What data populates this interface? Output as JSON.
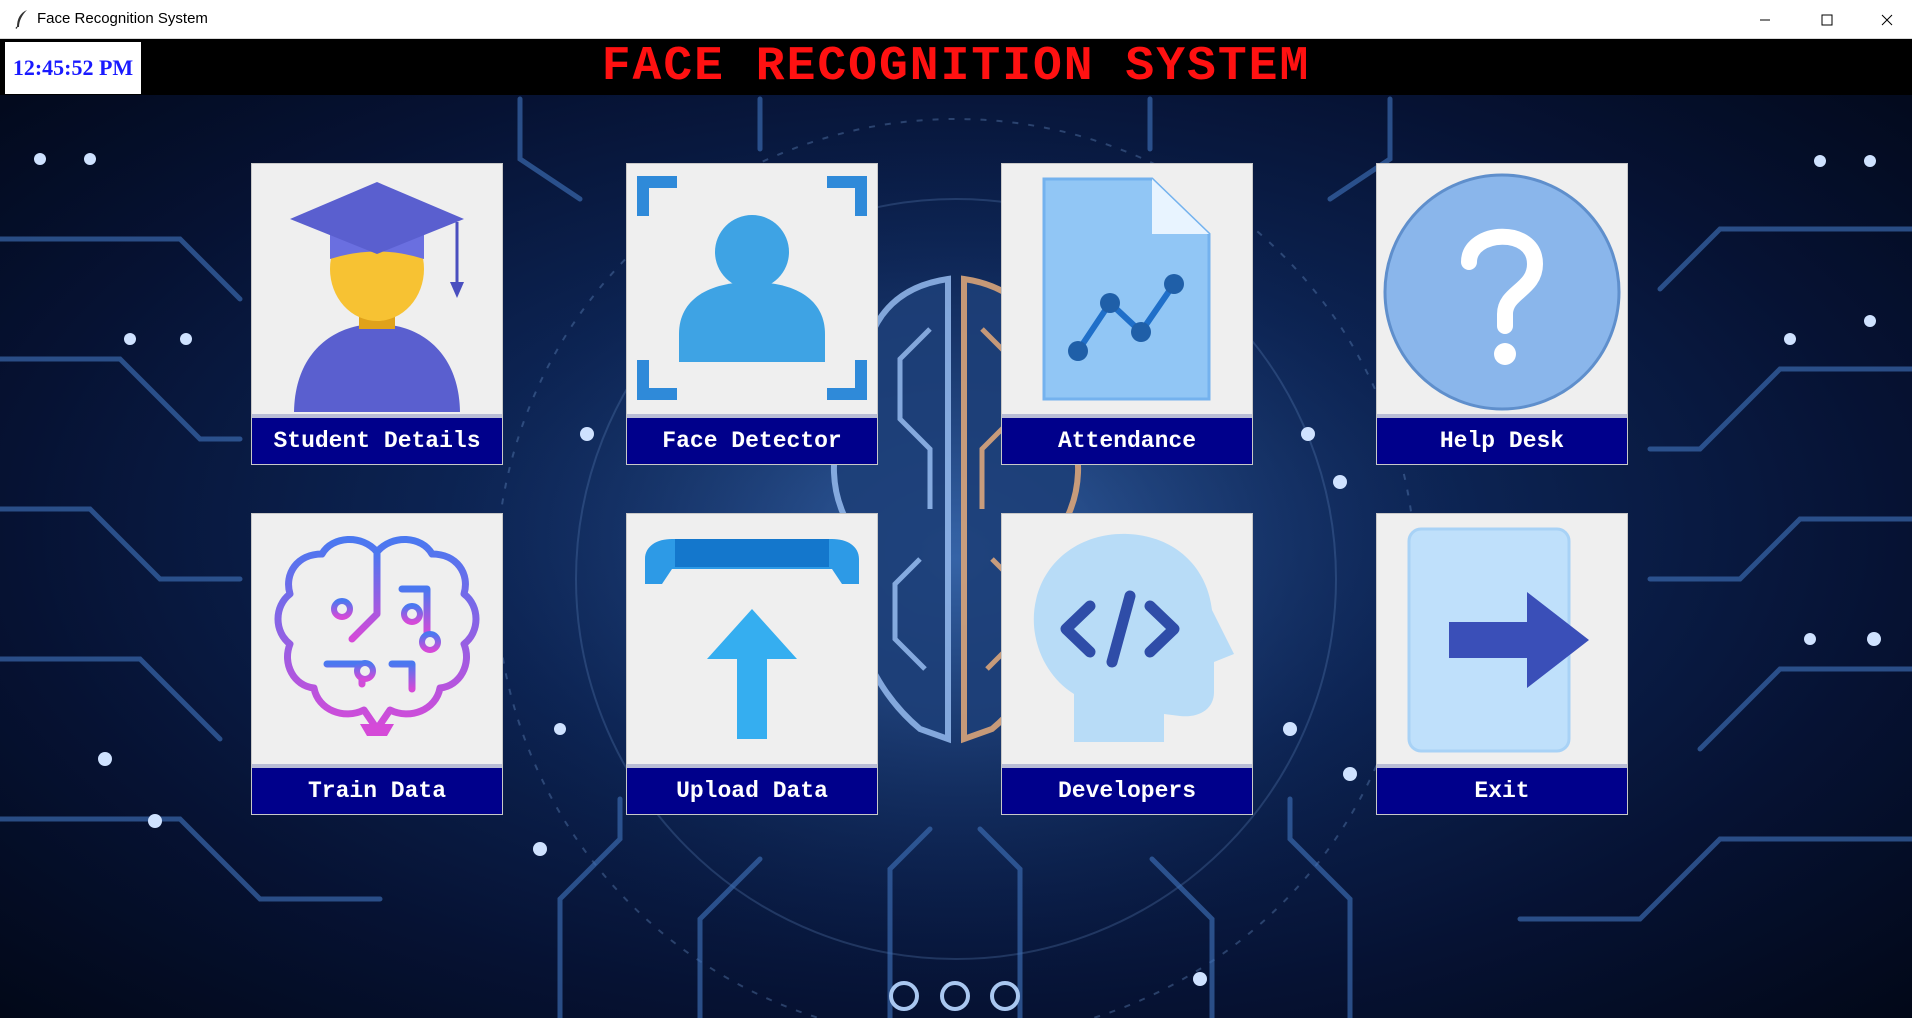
{
  "window": {
    "title": "Face Recognition System",
    "controls": {
      "minimize_icon": "minimize-icon",
      "maximize_icon": "maximize-icon",
      "close_icon": "close-icon"
    }
  },
  "header": {
    "title": "FACE RECOGNITION SYSTEM",
    "clock": "12:45:52 PM",
    "title_color": "#ff1111",
    "clock_color": "#1a1aff"
  },
  "tiles": [
    {
      "label": "Student Details",
      "icon": "student-graduate-icon"
    },
    {
      "label": "Face Detector",
      "icon": "face-scan-icon"
    },
    {
      "label": "Attendance",
      "icon": "attendance-report-icon"
    },
    {
      "label": "Help Desk",
      "icon": "help-question-icon"
    },
    {
      "label": "Train Data",
      "icon": "brain-circuit-icon"
    },
    {
      "label": "Upload Data",
      "icon": "upload-arrow-icon"
    },
    {
      "label": "Developers",
      "icon": "developer-code-head-icon"
    },
    {
      "label": "Exit",
      "icon": "exit-arrow-icon"
    }
  ],
  "colors": {
    "label_bg": "#00008b",
    "tile_bg": "#efefef",
    "background": "#0c2352"
  }
}
